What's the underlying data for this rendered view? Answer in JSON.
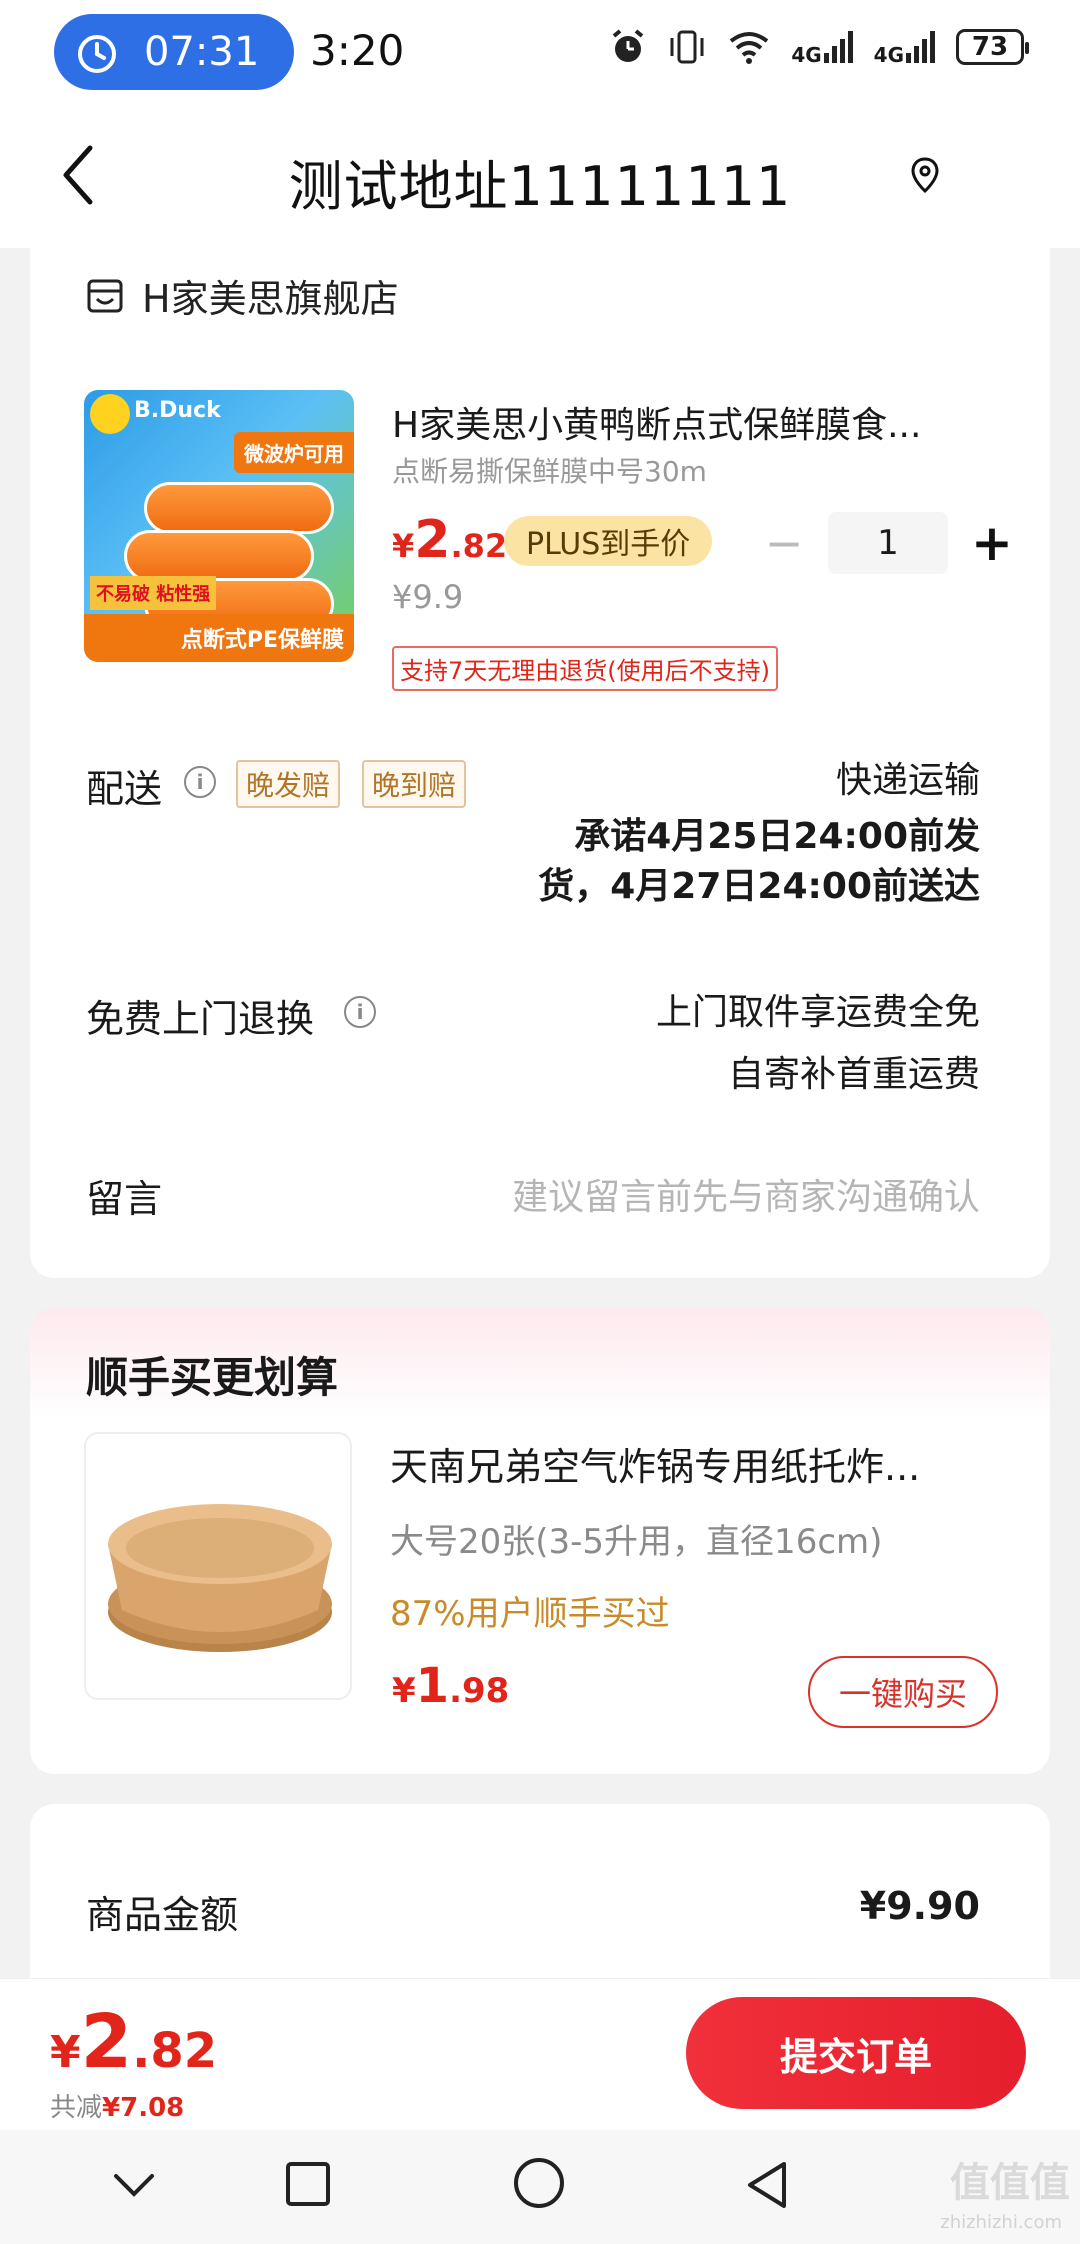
{
  "status_bar": {
    "timer": "07:31",
    "clock": "3:20",
    "network1": "4G",
    "network2": "4G",
    "battery": "73"
  },
  "header": {
    "address": "测试地址11111111"
  },
  "store": {
    "name": "H家美思旗舰店"
  },
  "product": {
    "title": "H家美思小黄鸭断点式保鲜膜食...",
    "spec": "点断易撕保鲜膜中号30m",
    "price_symbol": "¥",
    "price_int": "2",
    "price_dec": ".82",
    "plus_badge": "PLUS到手价",
    "original_price": "¥9.9",
    "quantity": "1",
    "return_policy": "支持7天无理由退货(使用后不支持)",
    "image_text": {
      "brand": "B.Duck",
      "top_tag": "微波炉可用",
      "bottom_banner": "点断式PE保鲜膜",
      "side_tag": "不易破 粘性强"
    }
  },
  "delivery": {
    "label": "配送",
    "tag1": "晚发赔",
    "tag2": "晚到赔",
    "method": "快递运输",
    "promise_line1": "承诺4月25日24:00前发",
    "promise_line2": "货，4月27日24:00前送达"
  },
  "free_return": {
    "label": "免费上门退换",
    "line1": "上门取件享运费全免",
    "line2": "自寄补首重运费"
  },
  "remark": {
    "label": "留言",
    "placeholder": "建议留言前先与商家沟通确认"
  },
  "recommend": {
    "section_title": "顺手买更划算",
    "title": "天南兄弟空气炸锅专用纸托炸...",
    "spec": "大号20张(3-5升用，直径16cm)",
    "bought_pct": "87%用户顺手买过",
    "price_symbol": "¥",
    "price_int": "1",
    "price_dec": ".98",
    "buy_button": "一键购买"
  },
  "summary": {
    "goods_amount_label": "商品金额",
    "goods_amount_value": "¥9.90"
  },
  "bottom_bar": {
    "total_symbol": "¥",
    "total_int": "2",
    "total_dec": ".82",
    "saved_prefix": "共减",
    "saved_value": "¥7.08",
    "submit": "提交订单"
  },
  "watermark": {
    "logo": "值值值",
    "site": "zhizhizhi.com"
  },
  "colors": {
    "accent_red": "#e1251b",
    "timer_blue": "#2f6fe6",
    "plus_gold": "#fbe3a3",
    "tag_brown": "#b07528"
  }
}
